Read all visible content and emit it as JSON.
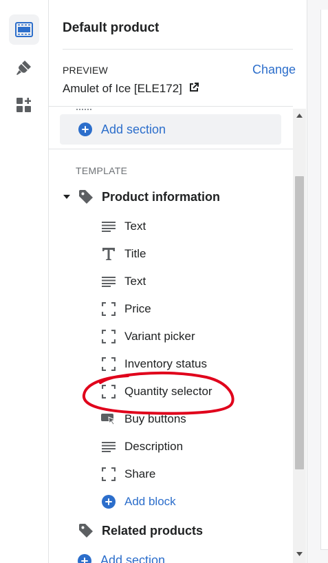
{
  "rail": {
    "items": [
      {
        "icon": "sections-icon",
        "active": true
      },
      {
        "icon": "theme-settings-icon",
        "active": false
      },
      {
        "icon": "app-embeds-icon",
        "active": false
      }
    ]
  },
  "panel": {
    "title": "Default product",
    "preview_label": "PREVIEW",
    "change_link": "Change",
    "preview_value": "Amulet of Ice [ELE172]",
    "add_section_label": "Add section",
    "template_label": "TEMPLATE",
    "sections": [
      {
        "label": "Product information",
        "blocks": [
          {
            "label": "Text",
            "icon": "text-lines-icon"
          },
          {
            "label": "Title",
            "icon": "title-t-icon"
          },
          {
            "label": "Text",
            "icon": "text-lines-icon"
          },
          {
            "label": "Price",
            "icon": "dashed-square-icon"
          },
          {
            "label": "Variant picker",
            "icon": "dashed-square-icon"
          },
          {
            "label": "Inventory status",
            "icon": "dashed-square-icon"
          },
          {
            "label": "Quantity selector",
            "icon": "dashed-square-icon"
          },
          {
            "label": "Buy buttons",
            "icon": "buy-buttons-icon"
          },
          {
            "label": "Description",
            "icon": "text-lines-icon"
          },
          {
            "label": "Share",
            "icon": "dashed-square-icon"
          }
        ],
        "add_block_label": "Add block"
      },
      {
        "label": "Related products"
      }
    ],
    "bottom_add_section_label": "Add section"
  },
  "colors": {
    "accent": "#2c6ecb",
    "annotation": "#e0001b"
  }
}
